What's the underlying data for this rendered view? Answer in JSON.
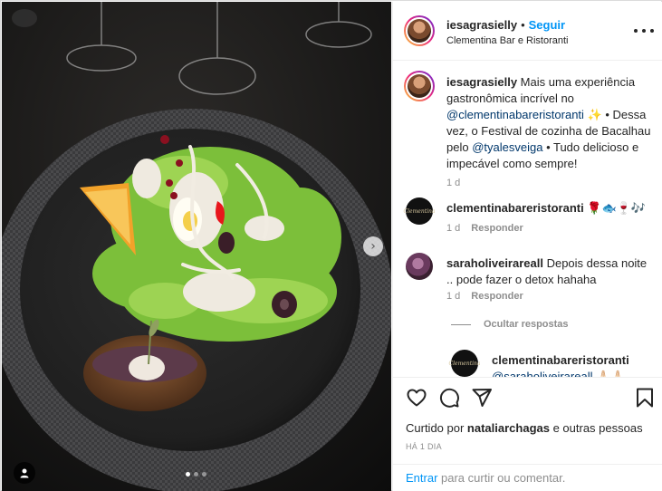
{
  "post": {
    "author": "iesagrasielly",
    "separator": "•",
    "follow_label": "Seguir",
    "location": "Clementina Bar e Ristoranti",
    "more_icon": "more-horizontal-icon"
  },
  "caption": {
    "author": "iesagrasielly",
    "text_1": " Mais uma experiência gastronômica incrível no ",
    "mention_1": "@clementinabareristoranti",
    "text_2": " ✨ • Dessa vez, o Festival de cozinha de Bacalhau pelo ",
    "mention_2": "@tyalesveiga",
    "text_3": " • Tudo delicioso e impecável como sempre!",
    "time": "1 d"
  },
  "comments": [
    {
      "author": "clementinabareristoranti",
      "text": " 🌹🐟🍷🎶",
      "time": "1 d",
      "reply_label": "Responder",
      "avatar_text": "Clementina"
    },
    {
      "author": "saraholiveirareall",
      "text": " Depois dessa noite .. pode fazer o detox hahaha",
      "time": "1 d",
      "reply_label": "Responder"
    }
  ],
  "hide_replies_label": "Ocultar respostas",
  "reply": {
    "author": "clementinabareristoranti",
    "text": "@saraholiveirareall 🙏🏻🙏🏻",
    "avatar_text": "Clementina"
  },
  "actions": {
    "icons": [
      "heart-icon",
      "comment-icon",
      "share-icon",
      "bookmark-icon"
    ]
  },
  "likes": {
    "prefix": "Curtido por ",
    "user": "nataliarchagas",
    "suffix": " e outras pessoas"
  },
  "date_label": "HÁ 1 DIA",
  "login": {
    "link": "Entrar",
    "text": " para curtir ou comentar."
  },
  "carousel": {
    "total": 3,
    "active": 1
  },
  "colors": {
    "accent": "#0095f6",
    "mention": "#00376b",
    "muted": "#8e8e8e",
    "text": "#262626"
  }
}
